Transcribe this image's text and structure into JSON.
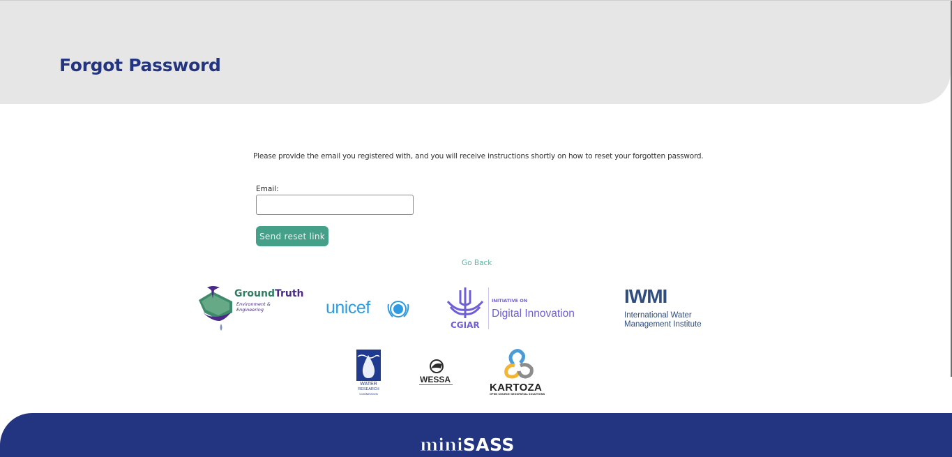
{
  "header": {
    "title": "Forgot Password"
  },
  "form": {
    "intro": "Please provide the email you registered with, and you will receive instructions shortly on how to reset your forgotten password.",
    "email_label": "Email:",
    "email_value": "",
    "email_placeholder": "",
    "submit_label": "Send reset link",
    "go_back_label": "Go Back"
  },
  "partners": {
    "groundtruth": {
      "name_1": "Ground",
      "name_2": "Truth",
      "tagline": "Environment & Engineering"
    },
    "unicef": {
      "name": "unicef"
    },
    "cgiar": {
      "org": "CGIAR",
      "small": "INITIATIVE ON",
      "big": "Digital Innovation"
    },
    "iwmi": {
      "mark": "IWMI",
      "line1": "International Water",
      "line2": "Management Institute"
    },
    "wrc": {
      "line1": "WATER",
      "line2": "RESEARCH",
      "line3": "COMMISSION"
    },
    "wessa": {
      "name": "WESSA"
    },
    "kartoza": {
      "name": "KARTOZA",
      "tagline": "OPEN SOURCE GEOSPATIAL SOLUTIONS"
    }
  },
  "footer": {
    "brand_mini": "mini",
    "brand_sass": "SASS"
  },
  "colors": {
    "brand_navy": "#233480",
    "button_green": "#45a08a",
    "link_teal": "#5fb3a2",
    "header_grey": "#e6e6e6"
  }
}
